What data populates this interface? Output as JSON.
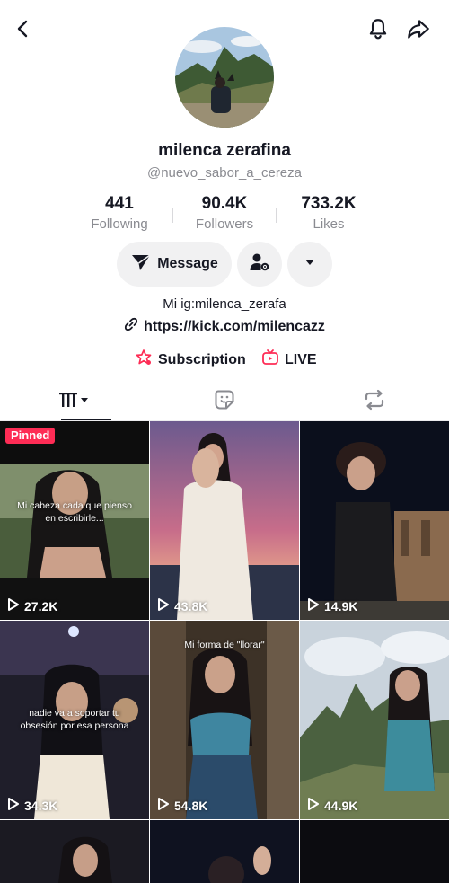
{
  "profile": {
    "name": "milenca zerafina",
    "handle": "@nuevo_sabor_a_cereza",
    "bio": "Mi ig:milenca_zerafa",
    "link": "https://kick.com/milencazz"
  },
  "stats": {
    "following": {
      "value": "441",
      "label": "Following"
    },
    "followers": {
      "value": "90.4K",
      "label": "Followers"
    },
    "likes": {
      "value": "733.2K",
      "label": "Likes"
    }
  },
  "actions": {
    "message_label": "Message"
  },
  "extras": {
    "subscription_label": "Subscription",
    "live_label": "LIVE"
  },
  "icons": {
    "back": "back-arrow-icon",
    "bell": "bell-icon",
    "share": "share-icon",
    "message": "send-icon",
    "add_friend": "person-settings-icon",
    "more": "caret-down-icon",
    "link": "link-icon",
    "subscription": "subscription-icon",
    "live": "live-tv-icon",
    "videos_tab": "video-grid-icon",
    "liked_tab": "liked-sticker-icon",
    "reposts_tab": "repost-icon",
    "play": "play-icon"
  },
  "colors": {
    "accent": "#fe2c55",
    "text": "#161823",
    "muted": "#8a8b91"
  },
  "grid": {
    "pinned_label": "Pinned",
    "videos": [
      {
        "views": "27.2K",
        "caption": "Mi cabeza cada que pienso en escribirle..."
      },
      {
        "views": "43.8K",
        "caption": ""
      },
      {
        "views": "14.9K",
        "caption": ""
      },
      {
        "views": "34.3K",
        "caption": "nadie va a soportar tu obsesión por esa persona"
      },
      {
        "views": "54.8K",
        "caption": "Mi forma de \"llorar\""
      },
      {
        "views": "44.9K",
        "caption": ""
      }
    ]
  }
}
